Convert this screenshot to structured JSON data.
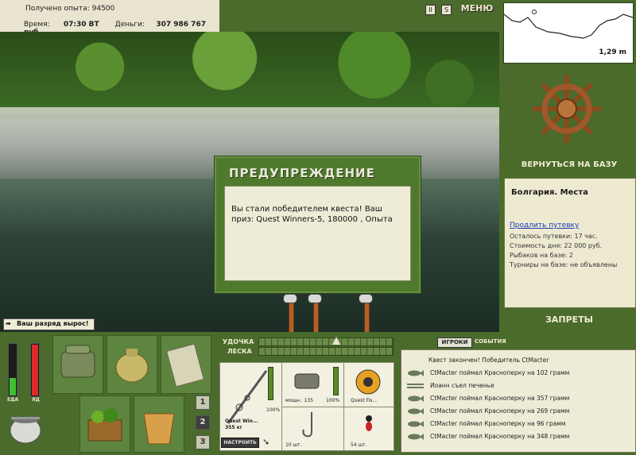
{
  "status": {
    "exp_label": "Получено опыта:",
    "exp_value": "94500",
    "time_label": "Время:",
    "time_value": "07:30 ВТ",
    "money_label": "Деньги:",
    "money_value": "307 986 767 руб."
  },
  "top_icons": [
    "pause-icon",
    "s-icon"
  ],
  "top_icon_s": "S",
  "menu_label": "МЕНЮ",
  "depth": {
    "value": "1,29 m"
  },
  "right_panel": {
    "back_to_base": "ВЕРНУТЬСЯ НА БАЗУ",
    "base_title": "Болгария. Места",
    "extend_link": "Продлить путевку",
    "lines": [
      "Осталось путевки: 17 час.",
      "Стоимость дня: 22 000 руб.",
      "Рыбаков на базе: 2",
      "Турниры на базе: не объявлены"
    ],
    "bans": "ЗАПРЕТЫ"
  },
  "popup": {
    "title": "ПРЕДУПРЕЖДЕНИЕ",
    "message": "Вы стали победителем квеста! Ваш приз: Quest Winners-5, 180000 , Опыта"
  },
  "rank_message": "Ваш разряд вырос!",
  "bars": {
    "food_label": "ЕДА",
    "poison_label": "ЯД",
    "food_level": 0.35,
    "poison_level": 1.0
  },
  "tabs_numbers": [
    "1",
    "2",
    "3"
  ],
  "selected_tab": "2",
  "sliders": {
    "rod_label": "УДОЧКА",
    "line_label": "ЛЕСКА",
    "rod_level": 0.58
  },
  "tackle": {
    "rod_name": "Quest Win...",
    "rod_weight": "355 кг",
    "rod_percent": "100%",
    "reel_power": "мощн.: 135",
    "reel_percent": "100%",
    "line_name": "Quest Fis...",
    "hooks_count": "10 шт.",
    "bait_count": "54 шт.",
    "setup_button": "НАСТРОИТЬ"
  },
  "events_tabs": {
    "players": "ИГРОКИ",
    "events": "СОБЫТИЯ"
  },
  "events": [
    {
      "icon": "quest-icon",
      "text": "Квест закончен! Победитель CtMacter"
    },
    {
      "icon": "fish-icon",
      "text": "CtMacter поймал Красноперку на 102 грамм"
    },
    {
      "icon": "fork-knife-icon",
      "text": "Иоанн съел печенье"
    },
    {
      "icon": "fish-icon",
      "text": "CtMacter поймал Красноперку на 357 грамм"
    },
    {
      "icon": "fish-icon",
      "text": "CtMacter поймал Красноперку на 269 грамм"
    },
    {
      "icon": "fish-icon",
      "text": "CtMacter поймал Красноперку на 96 грамм"
    },
    {
      "icon": "fish-icon",
      "text": "CtMacter поймал Красноперку на 348 грамм"
    }
  ],
  "colors": {
    "panel_green": "#4a6b2c",
    "light": "#eeecd6",
    "link": "#1a3bb5",
    "food_green": "#3fbf2f",
    "poison_red": "#e02a2a"
  }
}
